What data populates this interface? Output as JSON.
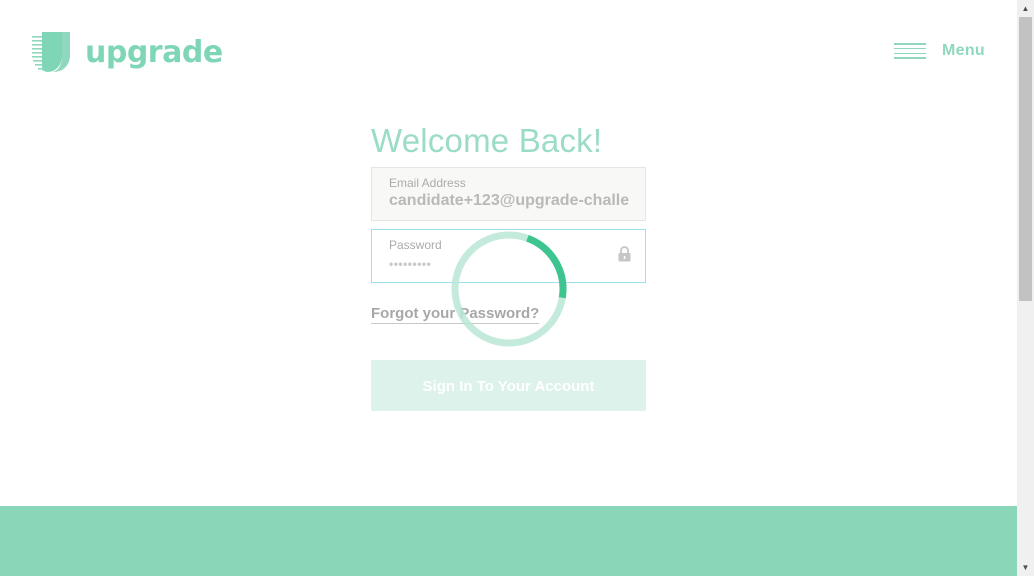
{
  "header": {
    "logo_text": "upgrade",
    "menu_label": "Menu"
  },
  "form": {
    "title": "Welcome Back!",
    "email": {
      "label": "Email Address",
      "value": "candidate+123@upgrade-challe"
    },
    "password": {
      "label": "Password",
      "value": "•••••••••"
    },
    "forgot_link": "Forgot your Password?",
    "submit_label": "Sign In To Your Account"
  },
  "spinner": {
    "progress": 0.22
  },
  "colors": {
    "brand": "#7fd6b6",
    "footer_band": "#89d6b8",
    "focus_border": "#9fe0f0",
    "button_disabled": "#dcf2ea"
  },
  "icons": {
    "logo": "upgrade-logo-icon",
    "menu": "hamburger-icon",
    "lock": "lock-icon",
    "spinner": "loading-spinner-icon"
  }
}
